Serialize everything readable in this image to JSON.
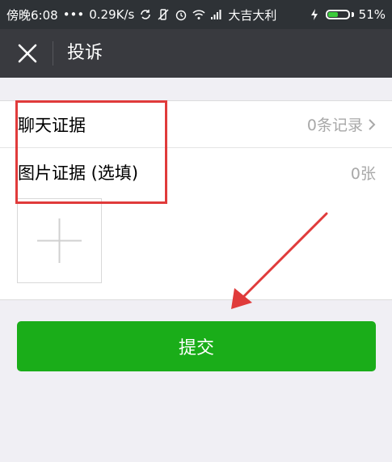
{
  "status_bar": {
    "time": "傍晚6:08",
    "dots": "•••",
    "net_speed": "0.29K/s",
    "carrier": "大吉大利",
    "battery_percent": "51%",
    "battery_level": 0.51,
    "icons": [
      "sync-icon",
      "vibrate-off-icon",
      "alarm-icon",
      "wifi-icon",
      "signal-icon",
      "charging-icon",
      "battery-icon"
    ]
  },
  "navbar": {
    "title": "投诉",
    "close_icon": "close-icon"
  },
  "chat_evidence": {
    "label": "聊天证据",
    "value": "0条记录"
  },
  "image_evidence": {
    "label": "图片证据 (选填)",
    "value": "0张"
  },
  "submit": {
    "label": "提交"
  },
  "colors": {
    "status_bar_bg": "#2e3236",
    "navbar_bg": "#393a3f",
    "page_bg": "#f0eff4",
    "primary_green": "#1aad19",
    "annotation_red": "#e03b3b",
    "secondary_text": "#a8a8a8"
  }
}
